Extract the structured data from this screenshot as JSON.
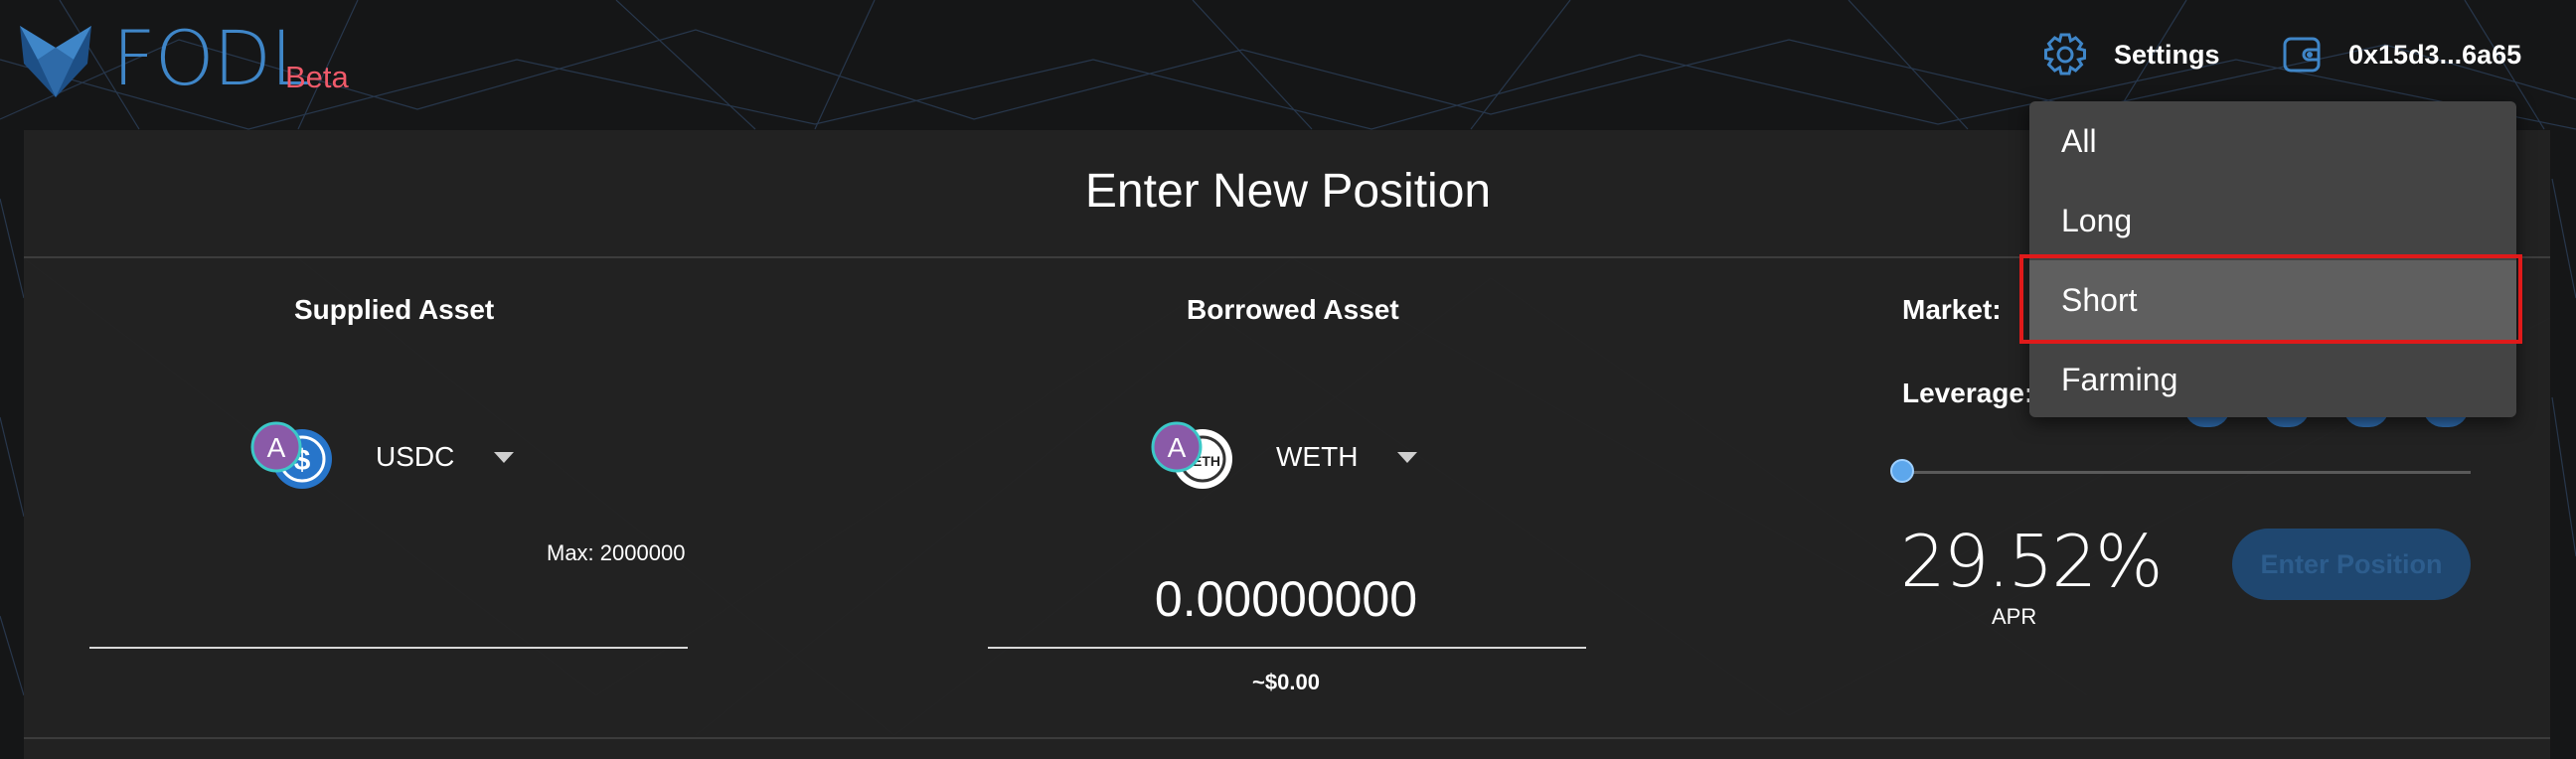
{
  "header": {
    "logo_text": "FODL",
    "beta_label": "Beta",
    "settings_label": "Settings",
    "wallet_address": "0x15d3...6a65"
  },
  "page": {
    "title": "Enter New Position"
  },
  "supplied": {
    "heading": "Supplied Asset",
    "asset": "USDC",
    "max_label": "Max: 2000000"
  },
  "borrowed": {
    "heading": "Borrowed Asset",
    "asset": "WETH",
    "amount": "0.00000000",
    "usd_value": "~$0.00"
  },
  "position": {
    "market_label": "Market:",
    "leverage_label": "Leverage:",
    "leverage_level": 0,
    "apr_value": "29.52%",
    "apr_label": "APR",
    "enter_button": "Enter Position"
  },
  "market_dropdown": {
    "items": [
      "All",
      "Long",
      "Short",
      "Farming"
    ],
    "selected": "Short"
  },
  "colors": {
    "brand_blue": "#3f86c8",
    "beta_red": "#f05a6a",
    "highlight_red": "#e01a1a"
  },
  "icons": [
    "fox-logo-icon",
    "gear-icon",
    "wallet-icon",
    "aave-usdc-icon",
    "aave-eth-icon",
    "caret-down-icon"
  ]
}
